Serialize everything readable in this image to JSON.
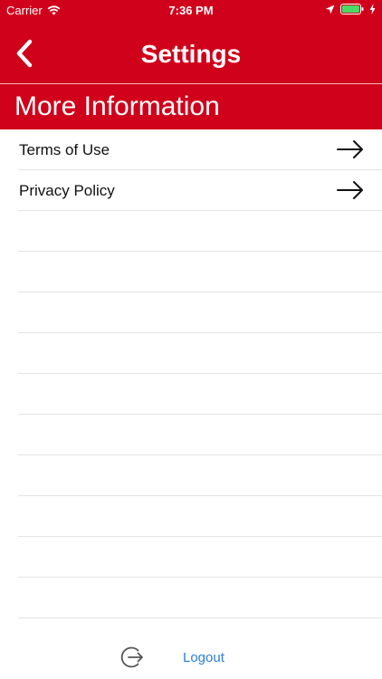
{
  "status_bar": {
    "carrier": "Carrier",
    "time": "7:36 PM"
  },
  "nav": {
    "title": "Settings",
    "back_icon": "chevron-left-icon"
  },
  "section": {
    "title": "More Information"
  },
  "list": {
    "items": [
      {
        "label": "Terms of Use",
        "icon": "arrow-right-icon"
      },
      {
        "label": "Privacy Policy",
        "icon": "arrow-right-icon"
      }
    ]
  },
  "footer": {
    "logout_label": "Logout",
    "logout_icon": "logout-icon"
  },
  "colors": {
    "brand_red": "#d0021b",
    "link_blue": "#2a7fd4",
    "battery_green": "#4cd964"
  }
}
